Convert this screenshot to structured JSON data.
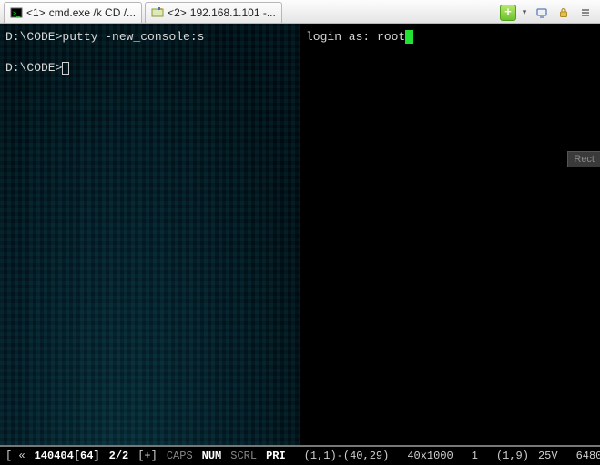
{
  "tabs": [
    {
      "num": "<1>",
      "label": "cmd.exe /k CD /...",
      "icon": "cmd"
    },
    {
      "num": "<2>",
      "label": "192.168.1.101 -...",
      "icon": "putty"
    }
  ],
  "toolbar": {
    "plus": "+",
    "lock_icon": "🔒",
    "gear_icon": "⚙",
    "monitor_icon": "↔"
  },
  "left_pane": {
    "prompt1": "D:\\CODE>",
    "command1": "putty -new_console:s",
    "prompt2": "D:\\CODE>"
  },
  "right_pane": {
    "login_label": "login as: ",
    "login_value": "root"
  },
  "faint": "Rect",
  "status": {
    "left_marker": "[ «",
    "timestamp": "140404[64]",
    "page": "2/2",
    "plus": "[+]",
    "caps": "CAPS",
    "num": "NUM",
    "scrl": "SCRL",
    "pri": "PRI",
    "sel": "(1,1)-(40,29)",
    "size": "40x1000",
    "one": "1",
    "cursor": "(1,9)",
    "scale": "25V",
    "right_num": "6480"
  }
}
